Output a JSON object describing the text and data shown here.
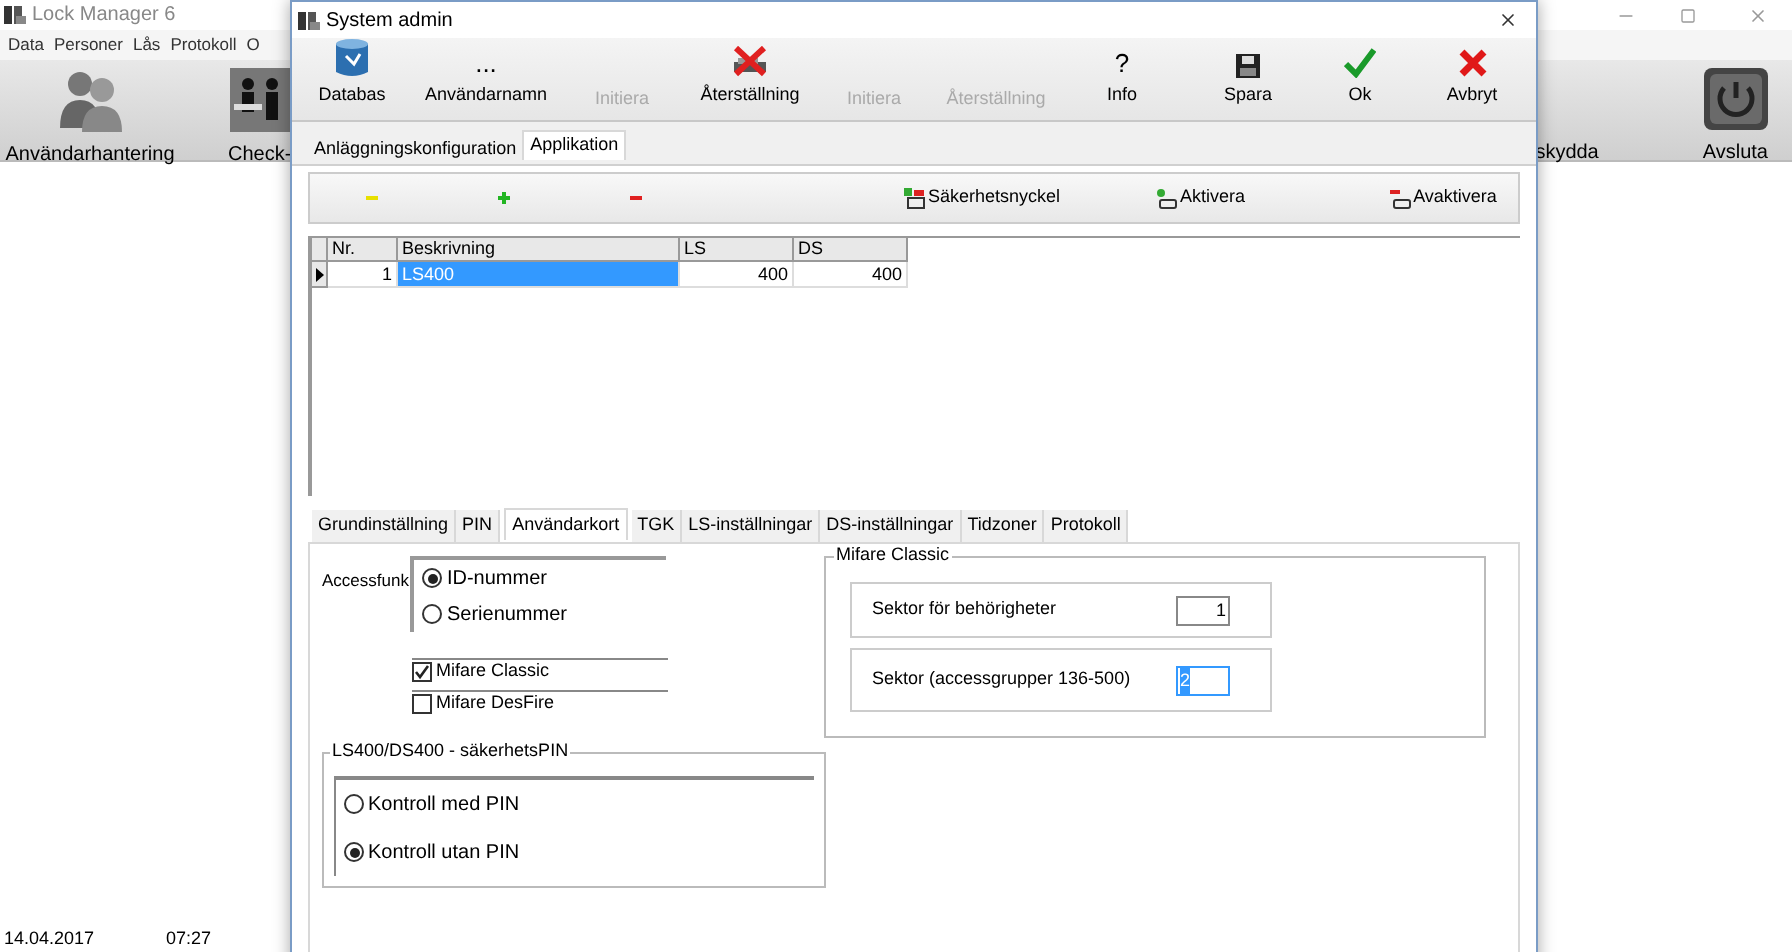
{
  "app": {
    "title": "Lock Manager 6",
    "menu": [
      "Data",
      "Personer",
      "Lås",
      "Protokoll",
      "O"
    ],
    "toolbar": [
      {
        "label": "Användarhantering",
        "kind": "users"
      },
      {
        "label": "Check-",
        "kind": "checkin"
      }
    ],
    "toolbar_right": [
      {
        "label": "skydda",
        "kind": "partial"
      },
      {
        "label": "Avsluta",
        "kind": "power"
      }
    ],
    "status": [
      "14.04.2017",
      "07:27"
    ]
  },
  "dialog": {
    "title": "System admin",
    "toolbar": [
      {
        "label": "Databas",
        "kind": "database",
        "disabled": false
      },
      {
        "label": "Användarnamn",
        "kind": "glyph",
        "glyph": "...",
        "disabled": false
      },
      {
        "label": "Initiera",
        "kind": "plain",
        "disabled": true
      },
      {
        "label": "Återställning",
        "kind": "reset",
        "disabled": false
      },
      {
        "label": "Initiera",
        "kind": "plain",
        "disabled": true
      },
      {
        "label": "Återställning",
        "kind": "plain",
        "disabled": true
      },
      {
        "label": "Info",
        "kind": "glyph",
        "glyph": "?",
        "disabled": false
      },
      {
        "label": "Spara",
        "kind": "save",
        "disabled": false
      },
      {
        "label": "Ok",
        "kind": "ok",
        "disabled": false
      },
      {
        "label": "Avbryt",
        "kind": "cancel",
        "disabled": false
      }
    ],
    "tabs": [
      {
        "label": "Anläggningskonfiguration",
        "selected": false
      },
      {
        "label": "Applikation",
        "selected": true
      }
    ],
    "edit_icons": [
      {
        "kind": "minus",
        "color": "#e8e000"
      },
      {
        "kind": "plus",
        "color": "#22b522"
      },
      {
        "kind": "minus",
        "color": "#e02020"
      }
    ],
    "actions": [
      {
        "label": "Säkerhetsnyckel",
        "kind": "key"
      },
      {
        "label": "Aktivera",
        "kind": "activate"
      },
      {
        "label": "Avaktivera",
        "kind": "deactivate"
      }
    ],
    "grid": {
      "columns": [
        "Nr.",
        "Beskrivning",
        "LS",
        "DS"
      ],
      "rows": [
        {
          "cells": [
            "1",
            "LS400",
            "400",
            "400"
          ],
          "selected": true
        }
      ]
    },
    "sub_tabs": [
      {
        "label": "Grundinställning",
        "selected": false
      },
      {
        "label": "PIN",
        "selected": false
      },
      {
        "label": "Användarkort",
        "selected": true
      },
      {
        "label": "TGK",
        "selected": false
      },
      {
        "label": "LS-inställningar",
        "selected": false
      },
      {
        "label": "DS-inställningar",
        "selected": false
      },
      {
        "label": "Tidzoner",
        "selected": false
      },
      {
        "label": "Protokoll",
        "selected": false
      }
    ],
    "access": {
      "label": "Accessfunk",
      "options": [
        {
          "label": "ID-nummer",
          "selected": true
        },
        {
          "label": "Serienummer",
          "selected": false
        }
      ]
    },
    "cards": [
      {
        "label": "Mifare Classic",
        "checked": true
      },
      {
        "label": "Mifare DesFire",
        "checked": false
      }
    ],
    "pin_group": {
      "title": "LS400/DS400 - säkerhetsPIN",
      "options": [
        {
          "label": "Kontroll med PIN",
          "selected": false
        },
        {
          "label": "Kontroll utan PIN",
          "selected": true
        }
      ]
    },
    "mifare": {
      "title": "Mifare Classic",
      "fields": [
        {
          "label": "Sektor för behörigheter",
          "value": "1",
          "focused": false
        },
        {
          "label": "Sektor (accessgrupper 136-500)",
          "value": "2",
          "focused": true
        }
      ]
    }
  }
}
